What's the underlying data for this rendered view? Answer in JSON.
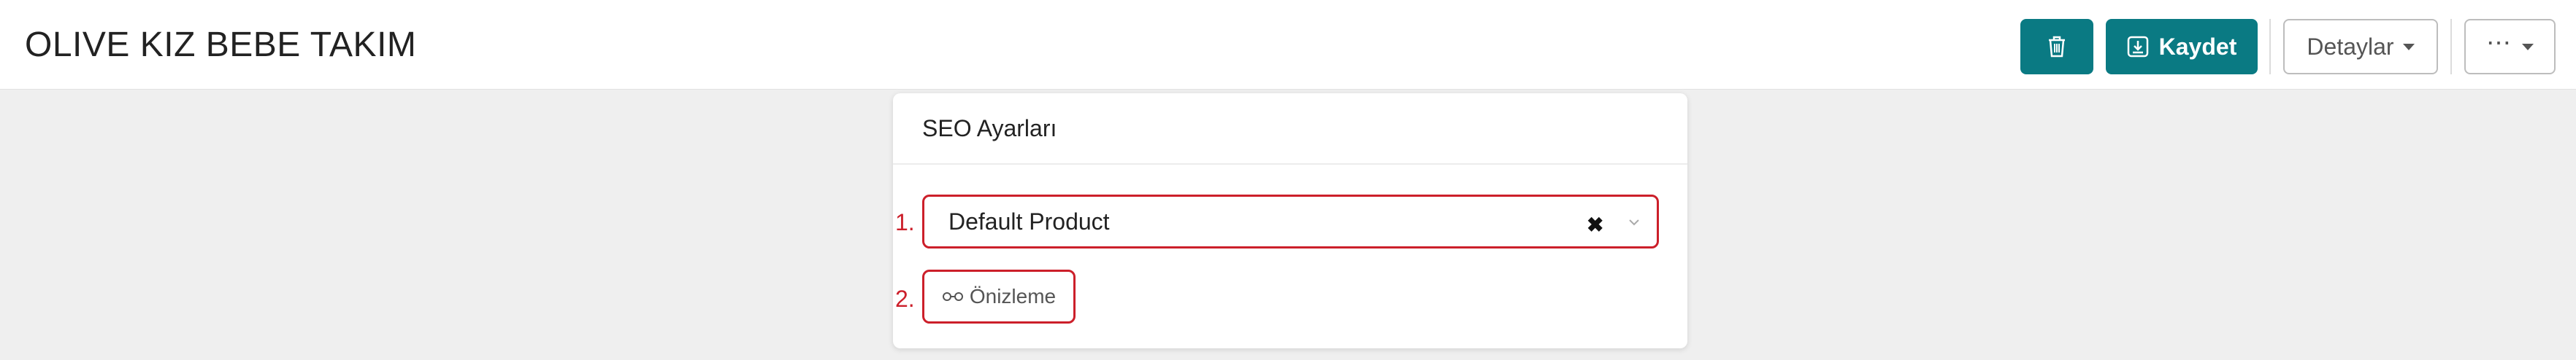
{
  "header": {
    "title": "OLIVE KIZ BEBE TAKIM",
    "delete_icon": "trash-icon",
    "save_label": "Kaydet",
    "save_icon": "save-download-icon",
    "details_label": "Detaylar",
    "more_label": "⋯"
  },
  "seo_card": {
    "title": "SEO Ayarları",
    "markers": [
      "1.",
      "2."
    ],
    "template_select": {
      "value": "Default Product",
      "clear_icon": "✖"
    },
    "preview_button": {
      "label": "Önizleme",
      "icon": "⚯"
    }
  },
  "colors": {
    "primary": "#0a7a83",
    "highlight": "#cc1f2a",
    "background": "#efefef"
  }
}
